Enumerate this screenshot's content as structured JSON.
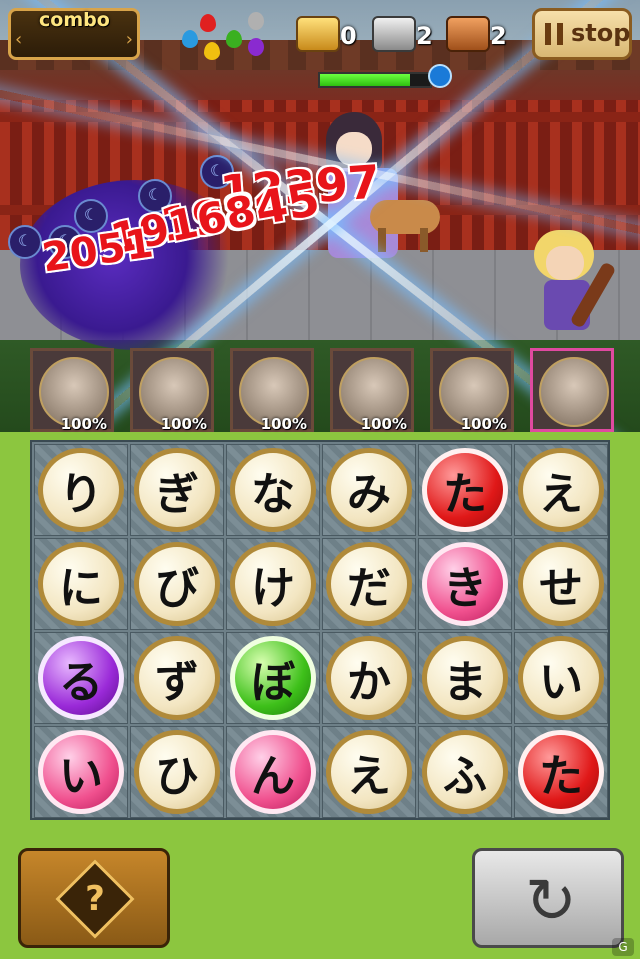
{
  "hud": {
    "combo_label": "combo",
    "combo_arrows": [
      "‹",
      "›"
    ],
    "elements": [
      {
        "name": "water",
        "color": "#2a9ae0"
      },
      {
        "name": "fire",
        "color": "#e02020"
      },
      {
        "name": "leaf",
        "color": "#3ab020"
      },
      {
        "name": "thunder",
        "color": "#f0c010"
      },
      {
        "name": "light",
        "color": "#b0b0b0"
      },
      {
        "name": "dark",
        "color": "#8a2ad0"
      }
    ],
    "chests": [
      {
        "type": "gold-chest",
        "count": "0"
      },
      {
        "type": "silver-chest",
        "count": "2"
      },
      {
        "type": "bronze-chest",
        "count": "2"
      }
    ],
    "stop_label": "stop",
    "enemy_hp_fraction": 0.82
  },
  "damage_numbers": [
    {
      "value": "12397"
    },
    {
      "value": "19845"
    },
    {
      "value": "19168"
    },
    {
      "value": "2051"
    }
  ],
  "party": [
    {
      "hp": "100%",
      "active": false
    },
    {
      "hp": "100%",
      "active": false
    },
    {
      "hp": "100%",
      "active": false
    },
    {
      "hp": "100%",
      "active": false
    },
    {
      "hp": "100%",
      "active": false
    },
    {
      "hp": "",
      "active": true
    }
  ],
  "board": {
    "rows": [
      [
        {
          "char": "り",
          "color": "cream"
        },
        {
          "char": "ぎ",
          "color": "cream"
        },
        {
          "char": "な",
          "color": "cream"
        },
        {
          "char": "み",
          "color": "cream"
        },
        {
          "char": "た",
          "color": "red"
        },
        {
          "char": "え",
          "color": "cream"
        }
      ],
      [
        {
          "char": "に",
          "color": "cream"
        },
        {
          "char": "び",
          "color": "cream"
        },
        {
          "char": "け",
          "color": "cream"
        },
        {
          "char": "だ",
          "color": "cream"
        },
        {
          "char": "き",
          "color": "pink"
        },
        {
          "char": "せ",
          "color": "cream"
        }
      ],
      [
        {
          "char": "る",
          "color": "purple"
        },
        {
          "char": "ず",
          "color": "cream"
        },
        {
          "char": "ぼ",
          "color": "green"
        },
        {
          "char": "か",
          "color": "cream"
        },
        {
          "char": "ま",
          "color": "cream"
        },
        {
          "char": "い",
          "color": "cream"
        }
      ],
      [
        {
          "char": "い",
          "color": "pink"
        },
        {
          "char": "ひ",
          "color": "cream"
        },
        {
          "char": "ん",
          "color": "pink"
        },
        {
          "char": "え",
          "color": "cream"
        },
        {
          "char": "ふ",
          "color": "cream"
        },
        {
          "char": "た",
          "color": "red"
        }
      ]
    ]
  },
  "buttons": {
    "hint_label": "?",
    "refresh_icon": "↻"
  },
  "watermark": "G"
}
